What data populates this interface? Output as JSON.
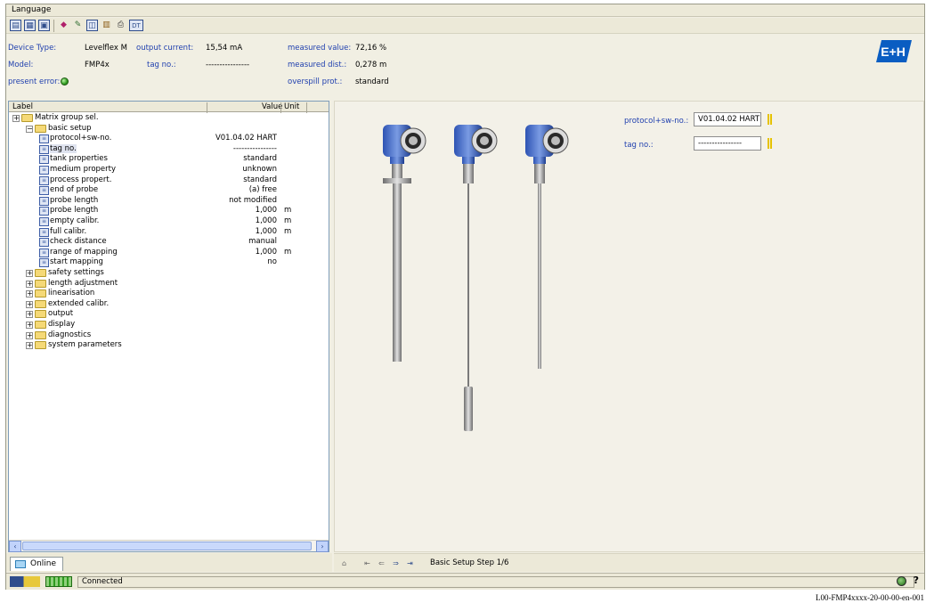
{
  "menubar": {
    "language": "Language"
  },
  "toolbar": {
    "icons": [
      "view-tree-icon",
      "view-table-icon",
      "view-graph-icon",
      "device-diagnostic-icon",
      "tools-icon",
      "envelope-curve-icon",
      "clipboard-icon",
      "print-icon",
      "dtm-icon"
    ],
    "dtm_label": "DT"
  },
  "info": {
    "device_type_label": "Device Type:",
    "device_type_value": "Levelflex M",
    "output_current_label": "output current:",
    "output_current_value": "15,54 mA",
    "measured_value_label": "measured value:",
    "measured_value_value": "72,16 %",
    "model_label": "Model:",
    "model_value": "FMP4x",
    "tag_no_label": "tag no.:",
    "tag_no_value": "----------------",
    "measured_dist_label": "measured dist.:",
    "measured_dist_value": "0,278 m",
    "present_error_label": "present error:",
    "overspill_label": "overspill prot.:",
    "overspill_value": "standard",
    "error_led_color": "#2f9b1f",
    "logo_text": "E+H",
    "brand_color": "#0a5dc2"
  },
  "tree": {
    "header": {
      "label": "Label",
      "value": "Value",
      "unit": "Unit"
    },
    "rows": [
      {
        "label": "Matrix group sel.",
        "value": "",
        "unit": "",
        "type": "group",
        "expanded": false,
        "indent": 0
      },
      {
        "label": "basic setup",
        "value": "",
        "unit": "",
        "type": "group",
        "expanded": true,
        "indent": 1
      },
      {
        "label": "protocol+sw-no.",
        "value": "V01.04.02 HART",
        "unit": "",
        "type": "param",
        "indent": 2
      },
      {
        "label": "tag no.",
        "value": "----------------",
        "unit": "",
        "type": "param",
        "indent": 2,
        "selected": true
      },
      {
        "label": "tank properties",
        "value": "standard",
        "unit": "",
        "type": "param",
        "indent": 2
      },
      {
        "label": "medium property",
        "value": "unknown",
        "unit": "",
        "type": "param",
        "indent": 2
      },
      {
        "label": "process propert.",
        "value": "standard",
        "unit": "",
        "type": "param",
        "indent": 2
      },
      {
        "label": "end of probe",
        "value": "(a) free",
        "unit": "",
        "type": "param",
        "indent": 2
      },
      {
        "label": "probe length",
        "value": "not modified",
        "unit": "",
        "type": "param",
        "indent": 2
      },
      {
        "label": "probe length",
        "value": "1,000",
        "unit": "m",
        "type": "param",
        "indent": 2
      },
      {
        "label": "empty calibr.",
        "value": "1,000",
        "unit": "m",
        "type": "param",
        "indent": 2
      },
      {
        "label": "full calibr.",
        "value": "1,000",
        "unit": "m",
        "type": "param",
        "indent": 2
      },
      {
        "label": "check distance",
        "value": "manual",
        "unit": "",
        "type": "param",
        "indent": 2
      },
      {
        "label": "range of mapping",
        "value": "1,000",
        "unit": "m",
        "type": "param",
        "indent": 2
      },
      {
        "label": "start mapping",
        "value": "no",
        "unit": "",
        "type": "param",
        "indent": 2
      },
      {
        "label": "safety settings",
        "value": "",
        "unit": "",
        "type": "group",
        "expanded": false,
        "indent": 1
      },
      {
        "label": "length adjustment",
        "value": "",
        "unit": "",
        "type": "group",
        "expanded": false,
        "indent": 1
      },
      {
        "label": "linearisation",
        "value": "",
        "unit": "",
        "type": "group",
        "expanded": false,
        "indent": 1
      },
      {
        "label": "extended calibr.",
        "value": "",
        "unit": "",
        "type": "group",
        "expanded": false,
        "indent": 1
      },
      {
        "label": "output",
        "value": "",
        "unit": "",
        "type": "group",
        "expanded": false,
        "indent": 1
      },
      {
        "label": "display",
        "value": "",
        "unit": "",
        "type": "group",
        "expanded": false,
        "indent": 1
      },
      {
        "label": "diagnostics",
        "value": "",
        "unit": "",
        "type": "group",
        "expanded": false,
        "indent": 1
      },
      {
        "label": "system parameters",
        "value": "",
        "unit": "",
        "type": "group",
        "expanded": false,
        "indent": 1
      }
    ]
  },
  "right": {
    "protocol_label": "protocol+sw-no.:",
    "protocol_value": "V01.04.02 HART",
    "tag_label": "tag no.:",
    "tag_value": "----------------"
  },
  "tabs": {
    "online": "Online"
  },
  "stepbar": {
    "text": "Basic Setup Step 1/6"
  },
  "status": {
    "connection": "Connected"
  },
  "caption": "L00-FMP4xxxx-20-00-00-en-001"
}
